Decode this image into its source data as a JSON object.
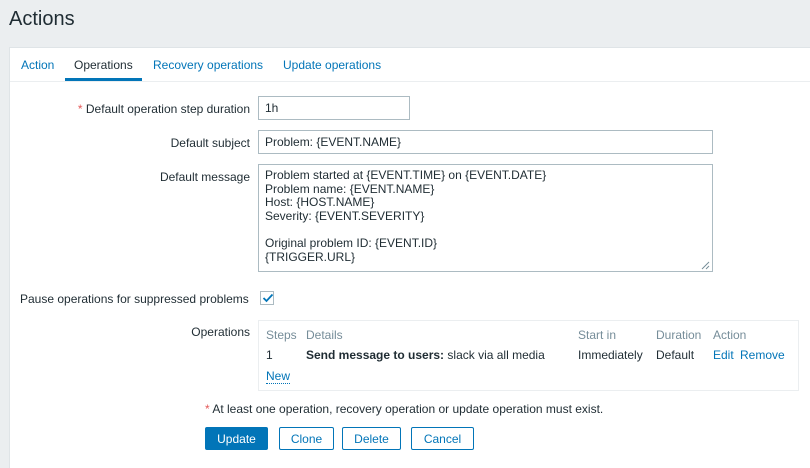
{
  "page": {
    "title": "Actions"
  },
  "tabs": [
    {
      "label": "Action"
    },
    {
      "label": "Operations"
    },
    {
      "label": "Recovery operations"
    },
    {
      "label": "Update operations"
    }
  ],
  "form": {
    "required_marker": "*",
    "step_duration": {
      "label": "Default operation step duration",
      "value": "1h"
    },
    "subject": {
      "label": "Default subject",
      "value": "Problem: {EVENT.NAME}"
    },
    "message": {
      "label": "Default message",
      "value": "Problem started at {EVENT.TIME} on {EVENT.DATE}\nProblem name: {EVENT.NAME}\nHost: {HOST.NAME}\nSeverity: {EVENT.SEVERITY}\n\nOriginal problem ID: {EVENT.ID}\n{TRIGGER.URL}"
    },
    "pause": {
      "label": "Pause operations for suppressed problems",
      "checked": true
    },
    "operations": {
      "label": "Operations",
      "headers": {
        "steps": "Steps",
        "details": "Details",
        "start_in": "Start in",
        "duration": "Duration",
        "action": "Action"
      },
      "rows": [
        {
          "steps": "1",
          "details_bold": "Send message to users:",
          "details_rest": " slack via all media",
          "start_in": "Immediately",
          "duration": "Default",
          "edit": "Edit",
          "remove": "Remove"
        }
      ],
      "new_link": "New"
    },
    "warning": "At least one operation, recovery operation or update operation must exist."
  },
  "buttons": {
    "update": "Update",
    "clone": "Clone",
    "delete": "Delete",
    "cancel": "Cancel"
  },
  "colors": {
    "accent": "#0275b8",
    "required": "#e45959",
    "background": "#ebeef0",
    "text": "#1f2c33"
  }
}
